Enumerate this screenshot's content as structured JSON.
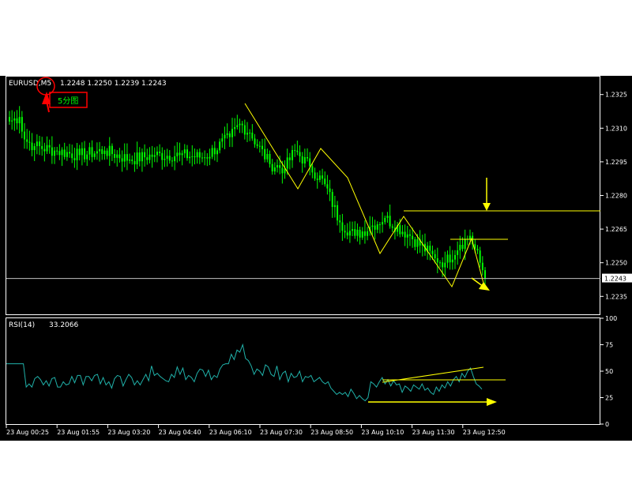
{
  "chart_data": [
    {
      "type": "candlestick",
      "symbol_label": "EURUSD,M5",
      "ohlc_label": "1.2248 1.2250 1.2239 1.2243",
      "annotation_label": "5分图",
      "current_price_label": "1.2243",
      "current_price": 1.2243,
      "ylim": [
        1.2227,
        1.2333
      ],
      "y_ticks": [
        "1.2325",
        "1.2310",
        "1.2295",
        "1.2280",
        "1.2265",
        "1.2250",
        "1.2235"
      ],
      "y_tick_values": [
        1.2325,
        1.231,
        1.2295,
        1.228,
        1.2265,
        1.225,
        1.2235
      ],
      "colors": {
        "bull": "#00ff00",
        "bear": "#00ff00",
        "background": "#000000",
        "annotation": "#ffff00"
      },
      "close_anchors": [
        [
          0,
          1.2313
        ],
        [
          4,
          1.2315
        ],
        [
          6,
          1.2305
        ],
        [
          10,
          1.2302
        ],
        [
          18,
          1.23
        ],
        [
          28,
          1.2298
        ],
        [
          38,
          1.23
        ],
        [
          48,
          1.2296
        ],
        [
          58,
          1.2298
        ],
        [
          68,
          1.2298
        ],
        [
          78,
          1.2297
        ],
        [
          88,
          1.2306
        ],
        [
          92,
          1.2312
        ],
        [
          96,
          1.2308
        ],
        [
          104,
          1.2294
        ],
        [
          110,
          1.2292
        ],
        [
          114,
          1.23
        ],
        [
          120,
          1.2293
        ],
        [
          126,
          1.2285
        ],
        [
          132,
          1.2268
        ],
        [
          138,
          1.2262
        ],
        [
          144,
          1.2266
        ],
        [
          150,
          1.227
        ],
        [
          160,
          1.2262
        ],
        [
          170,
          1.2252
        ],
        [
          174,
          1.225
        ],
        [
          180,
          1.2258
        ],
        [
          184,
          1.2262
        ],
        [
          188,
          1.225
        ],
        [
          190,
          1.2243
        ]
      ]
    },
    {
      "type": "line",
      "title": "RSI(14)",
      "value_label": "33.2066",
      "ylim": [
        0,
        100
      ],
      "y_ticks": [
        "100",
        "75",
        "50",
        "25",
        "0"
      ],
      "y_tick_values": [
        100,
        75,
        50,
        25,
        0
      ],
      "color": "#20b2aa",
      "values": [
        57,
        57,
        57,
        57,
        57,
        57,
        57,
        35,
        38,
        35,
        43,
        45,
        42,
        37,
        41,
        36,
        43,
        44,
        35,
        35,
        40,
        37,
        38,
        45,
        39,
        46,
        46,
        37,
        45,
        45,
        41,
        46,
        47,
        38,
        44,
        37,
        40,
        34,
        43,
        46,
        45,
        36,
        42,
        47,
        44,
        37,
        41,
        37,
        42,
        47,
        41,
        55,
        46,
        48,
        45,
        43,
        41,
        40,
        47,
        44,
        54,
        47,
        53,
        42,
        46,
        44,
        40,
        48,
        52,
        51,
        45,
        51,
        42,
        46,
        44,
        52,
        56,
        57,
        57,
        66,
        61,
        70,
        68,
        75,
        62,
        60,
        55,
        47,
        52,
        50,
        46,
        56,
        54,
        47,
        45,
        55,
        42,
        48,
        50,
        40,
        48,
        44,
        45,
        50,
        40,
        45,
        44,
        46,
        40,
        42,
        44,
        40,
        38,
        40,
        34,
        31,
        28,
        30,
        28,
        30,
        26,
        33,
        29,
        24,
        27,
        24,
        22,
        25,
        40,
        38,
        35,
        40,
        44,
        38,
        42,
        36,
        41,
        37,
        38,
        30,
        36,
        34,
        31,
        37,
        35,
        33,
        38,
        32,
        34,
        30,
        28,
        35,
        31,
        37,
        34,
        40,
        36,
        42,
        45,
        40,
        48,
        44,
        50,
        53,
        45,
        38,
        36,
        33
      ]
    }
  ],
  "x_ticks": [
    "23 Aug 00:25",
    "23 Aug 01:55",
    "23 Aug 03:20",
    "23 Aug 04:40",
    "23 Aug 06:10",
    "23 Aug 07:30",
    "23 Aug 08:50",
    "23 Aug 10:10",
    "23 Aug 11:30",
    "23 Aug 12:50"
  ]
}
